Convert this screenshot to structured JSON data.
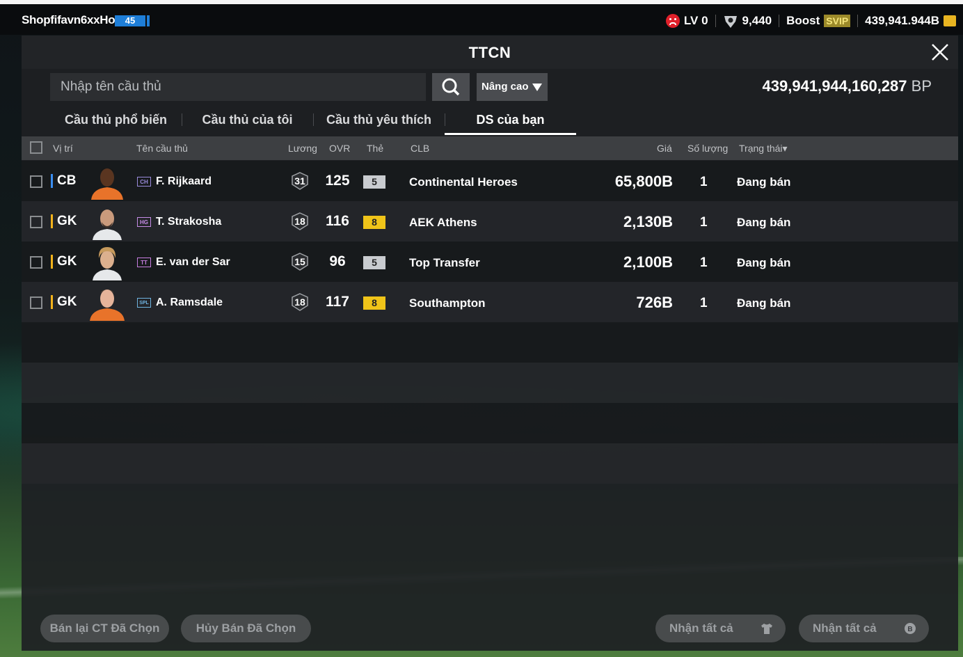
{
  "topbar": {
    "username": "Shopfifavn6xxHol",
    "level": "45",
    "lv_label": "LV 0",
    "trophy_value": "9,440",
    "boost_label": "Boost",
    "svip_label": "SVIP",
    "balance": "439,941.944B"
  },
  "panel": {
    "title": "TTCN",
    "search_placeholder": "Nhập tên cầu thủ",
    "advanced_label": "Nâng cao",
    "bp_amount": "439,941,944,160,287",
    "bp_unit": "BP"
  },
  "tabs": [
    {
      "label": "Cầu thủ phổ biến"
    },
    {
      "label": "Cầu thủ của tôi"
    },
    {
      "label": "Cầu thủ yêu thích"
    },
    {
      "label": "DS của bạn"
    }
  ],
  "columns": {
    "position": "Vị trí",
    "name": "Tên cầu thủ",
    "salary": "Lương",
    "ovr": "OVR",
    "card": "Thẻ",
    "club": "CLB",
    "price": "Giá",
    "quantity": "Số lượng",
    "status": "Trạng thái"
  },
  "players": [
    {
      "position": "CB",
      "pos_color": "#3a8ef0",
      "season": "CH",
      "season_color": "#9a8bdc",
      "name": "F. Rijkaard",
      "salary": "31",
      "ovr": "125",
      "grade": "5",
      "grade_color": "#c9ccd0",
      "club": "Continental Heroes",
      "price": "65,800B",
      "qty": "1",
      "status": "Đang bán"
    },
    {
      "position": "GK",
      "pos_color": "#f2b21b",
      "season": "HG",
      "season_color": "#c58be6",
      "name": "T. Strakosha",
      "salary": "18",
      "ovr": "116",
      "grade": "8",
      "grade_color": "#f0c419",
      "club": "AEK Athens",
      "price": "2,130B",
      "qty": "1",
      "status": "Đang bán"
    },
    {
      "position": "GK",
      "pos_color": "#f2b21b",
      "season": "TT",
      "season_color": "#c77de0",
      "name": "E. van der Sar",
      "salary": "15",
      "ovr": "96",
      "grade": "5",
      "grade_color": "#c9ccd0",
      "club": "Top Transfer",
      "price": "2,100B",
      "qty": "1",
      "status": "Đang bán"
    },
    {
      "position": "GK",
      "pos_color": "#f2b21b",
      "season": "SPL",
      "season_color": "#6fb4e0",
      "name": "A. Ramsdale",
      "salary": "18",
      "ovr": "117",
      "grade": "8",
      "grade_color": "#f0c419",
      "club": "Southampton",
      "price": "726B",
      "qty": "1",
      "status": "Đang bán"
    }
  ],
  "footer": {
    "resell_label": "Bán lại CT Đã Chọn",
    "cancel_label": "Hủy Bán Đã Chọn",
    "collect_all_1": "Nhận tất cả",
    "collect_all_2": "Nhận tất cả"
  }
}
